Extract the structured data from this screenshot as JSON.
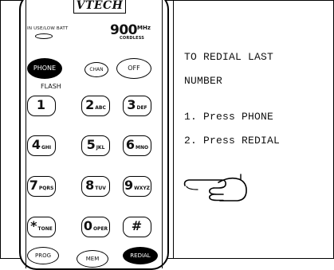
{
  "phone": {
    "brand": "VTECH",
    "indicator_label": "IN USE/LOW BATT",
    "frequency": "900",
    "frequency_unit": "MHz",
    "cordless_label": "CORDLESS",
    "buttons": {
      "phone": "PHONE",
      "chan": "CHAN",
      "off": "OFF",
      "flash": "FLASH",
      "prog": "PROG",
      "mem": "MEM",
      "redial": "REDIAL"
    },
    "keypad": [
      {
        "digit": "1",
        "sub": ""
      },
      {
        "digit": "2",
        "sub": "ABC"
      },
      {
        "digit": "3",
        "sub": "DEF"
      },
      {
        "digit": "4",
        "sub": "GHI"
      },
      {
        "digit": "5",
        "sub": "JKL"
      },
      {
        "digit": "6",
        "sub": "MNO"
      },
      {
        "digit": "7",
        "sub": "PQRS"
      },
      {
        "digit": "8",
        "sub": "TUV"
      },
      {
        "digit": "9",
        "sub": "WXYZ"
      },
      {
        "digit": "*",
        "sub": "TONE"
      },
      {
        "digit": "0",
        "sub": "OPER"
      },
      {
        "digit": "#",
        "sub": ""
      }
    ]
  },
  "instructions": {
    "title_line1": "TO REDIAL LAST",
    "title_line2": "NUMBER",
    "step1": "1. Press PHONE",
    "step2": "2. Press REDIAL"
  },
  "icons": {
    "pointer": "pointing-hand-icon"
  }
}
